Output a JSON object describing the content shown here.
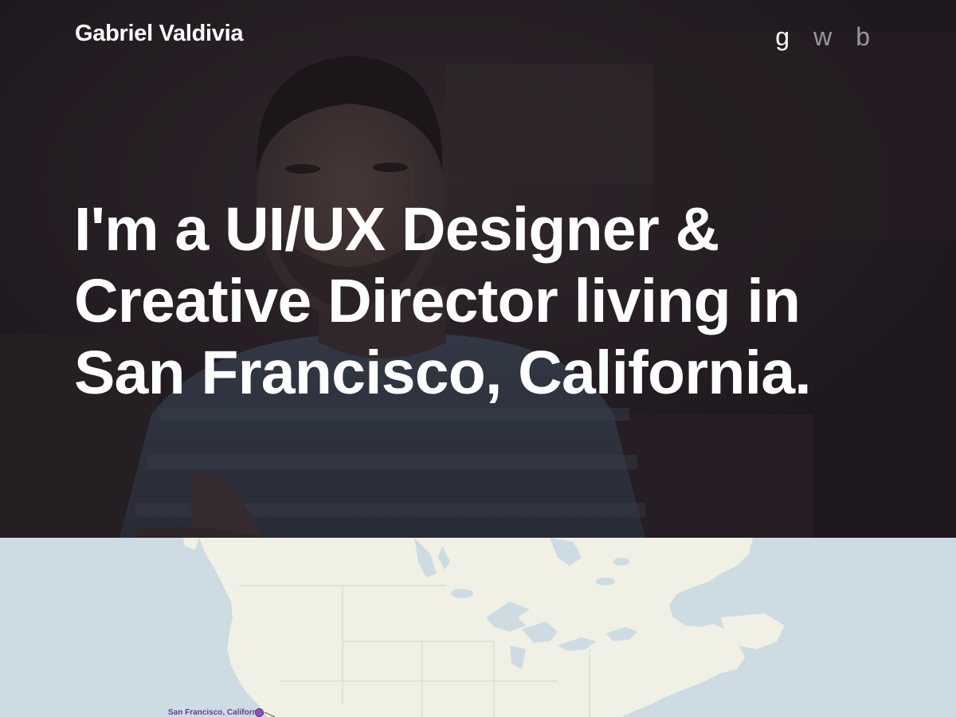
{
  "header": {
    "brand": "Gabriel Valdivia",
    "social_links": [
      {
        "label": "g",
        "icon": "google-plus-icon"
      },
      {
        "label": "w",
        "icon": "twitter-icon"
      },
      {
        "label": "b",
        "icon": "behance-icon"
      }
    ]
  },
  "hero": {
    "headline": "I'm a UI/UX Designer & Creative Director living in San Francisco, California."
  },
  "map": {
    "marker_label": "San Francisco, California",
    "colors": {
      "water": "#cddce3",
      "land": "#f1f0e4",
      "marker": "#8a55b8",
      "label": "#6a3a92"
    }
  }
}
